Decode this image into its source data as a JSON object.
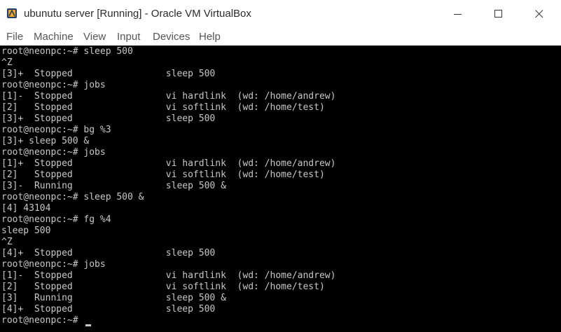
{
  "window": {
    "title": "ubunutu server [Running] - Oracle VM VirtualBox"
  },
  "menu": [
    "File",
    "Machine",
    "View",
    "Input",
    "Devices",
    "Help"
  ],
  "terminal": {
    "lines": [
      "root@neonpc:~# sleep 500",
      "^Z",
      "[3]+  Stopped                 sleep 500",
      "root@neonpc:~# jobs",
      "[1]-  Stopped                 vi hardlink  (wd: /home/andrew)",
      "[2]   Stopped                 vi softlink  (wd: /home/test)",
      "[3]+  Stopped                 sleep 500",
      "root@neonpc:~# bg %3",
      "[3]+ sleep 500 &",
      "root@neonpc:~# jobs",
      "[1]+  Stopped                 vi hardlink  (wd: /home/andrew)",
      "[2]   Stopped                 vi softlink  (wd: /home/test)",
      "[3]-  Running                 sleep 500 &",
      "root@neonpc:~# sleep 500 &",
      "[4] 43104",
      "root@neonpc:~# fg %4",
      "sleep 500",
      "^Z",
      "[4]+  Stopped                 sleep 500",
      "root@neonpc:~# jobs",
      "[1]-  Stopped                 vi hardlink  (wd: /home/andrew)",
      "[2]   Stopped                 vi softlink  (wd: /home/test)",
      "[3]   Running                 sleep 500 &",
      "[4]+  Stopped                 sleep 500",
      "root@neonpc:~#"
    ]
  },
  "colors": {
    "terminal_bg": "#000000",
    "terminal_fg": "#c8c8c8",
    "titlebar_bg": "#ffffff",
    "menu_fg": "#555555"
  },
  "icons": {
    "app": "virtualbox-icon",
    "minimize": "minimize-icon",
    "maximize": "maximize-icon",
    "close": "close-icon"
  }
}
